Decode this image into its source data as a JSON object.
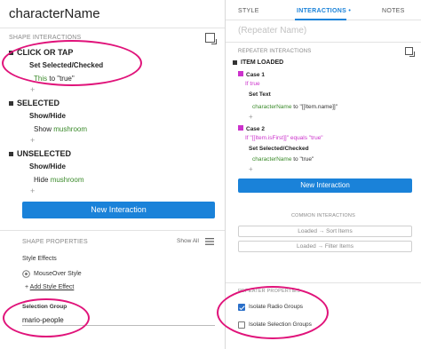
{
  "left": {
    "title": "characterName",
    "shape_interactions_header": "SHAPE INTERACTIONS",
    "events": [
      {
        "name": "CLICK OR TAP",
        "action": "Set Selected/Checked",
        "detail_pre": "",
        "detail_green": "This",
        "detail_post": " to \"true\""
      },
      {
        "name": "SELECTED",
        "action": "Show/Hide",
        "detail_pre": "Show ",
        "detail_green": "mushroom",
        "detail_post": ""
      },
      {
        "name": "UNSELECTED",
        "action": "Show/Hide",
        "detail_pre": "Hide ",
        "detail_green": "mushroom",
        "detail_post": ""
      }
    ],
    "plus": "+",
    "new_interaction": "New Interaction",
    "shape_properties_header": "SHAPE PROPERTIES",
    "show_all": "Show All",
    "style_effects": "Style Effects",
    "mouseover_style": "MouseOver Style",
    "add_style_effect": "Add Style Effect",
    "selection_group_label": "Selection Group",
    "selection_group_value": "mario-people"
  },
  "right": {
    "tabs": [
      "STYLE",
      "INTERACTIONS",
      "NOTES"
    ],
    "active_tab_marker": "•",
    "name_placeholder": "(Repeater Name)",
    "repeater_interactions_header": "REPEATER INTERACTIONS",
    "item_loaded": "ITEM LOADED",
    "case1": {
      "label": "Case 1",
      "condition": "If true",
      "action": "Set Text",
      "detail_green": "characterName",
      "detail_post": " to \"[[Item.name]]\""
    },
    "case2": {
      "label": "Case 2",
      "condition": "If \"[[Item.isFirst]]\" equals \"true\"",
      "action": "Set Selected/Checked",
      "detail_green": "characterName",
      "detail_post": " to \"true\""
    },
    "plus": "+",
    "new_interaction": "New Interaction",
    "common_interactions_header": "COMMON INTERACTIONS",
    "loaded_sort": "Loaded → Sort Items",
    "loaded_filter": "Loaded → Filter Items",
    "repeater_properties_header": "REPEATER PROPERTIES",
    "isolate_radio": "Isolate Radio Groups",
    "isolate_radio_checked": true,
    "isolate_selection": "Isolate Selection Groups",
    "isolate_selection_checked": false
  },
  "colors": {
    "accent": "#1a82d9",
    "highlight_ellipse": "#e0137a",
    "green_text": "#3a8a2a",
    "case_badge": "#cc33cc"
  }
}
